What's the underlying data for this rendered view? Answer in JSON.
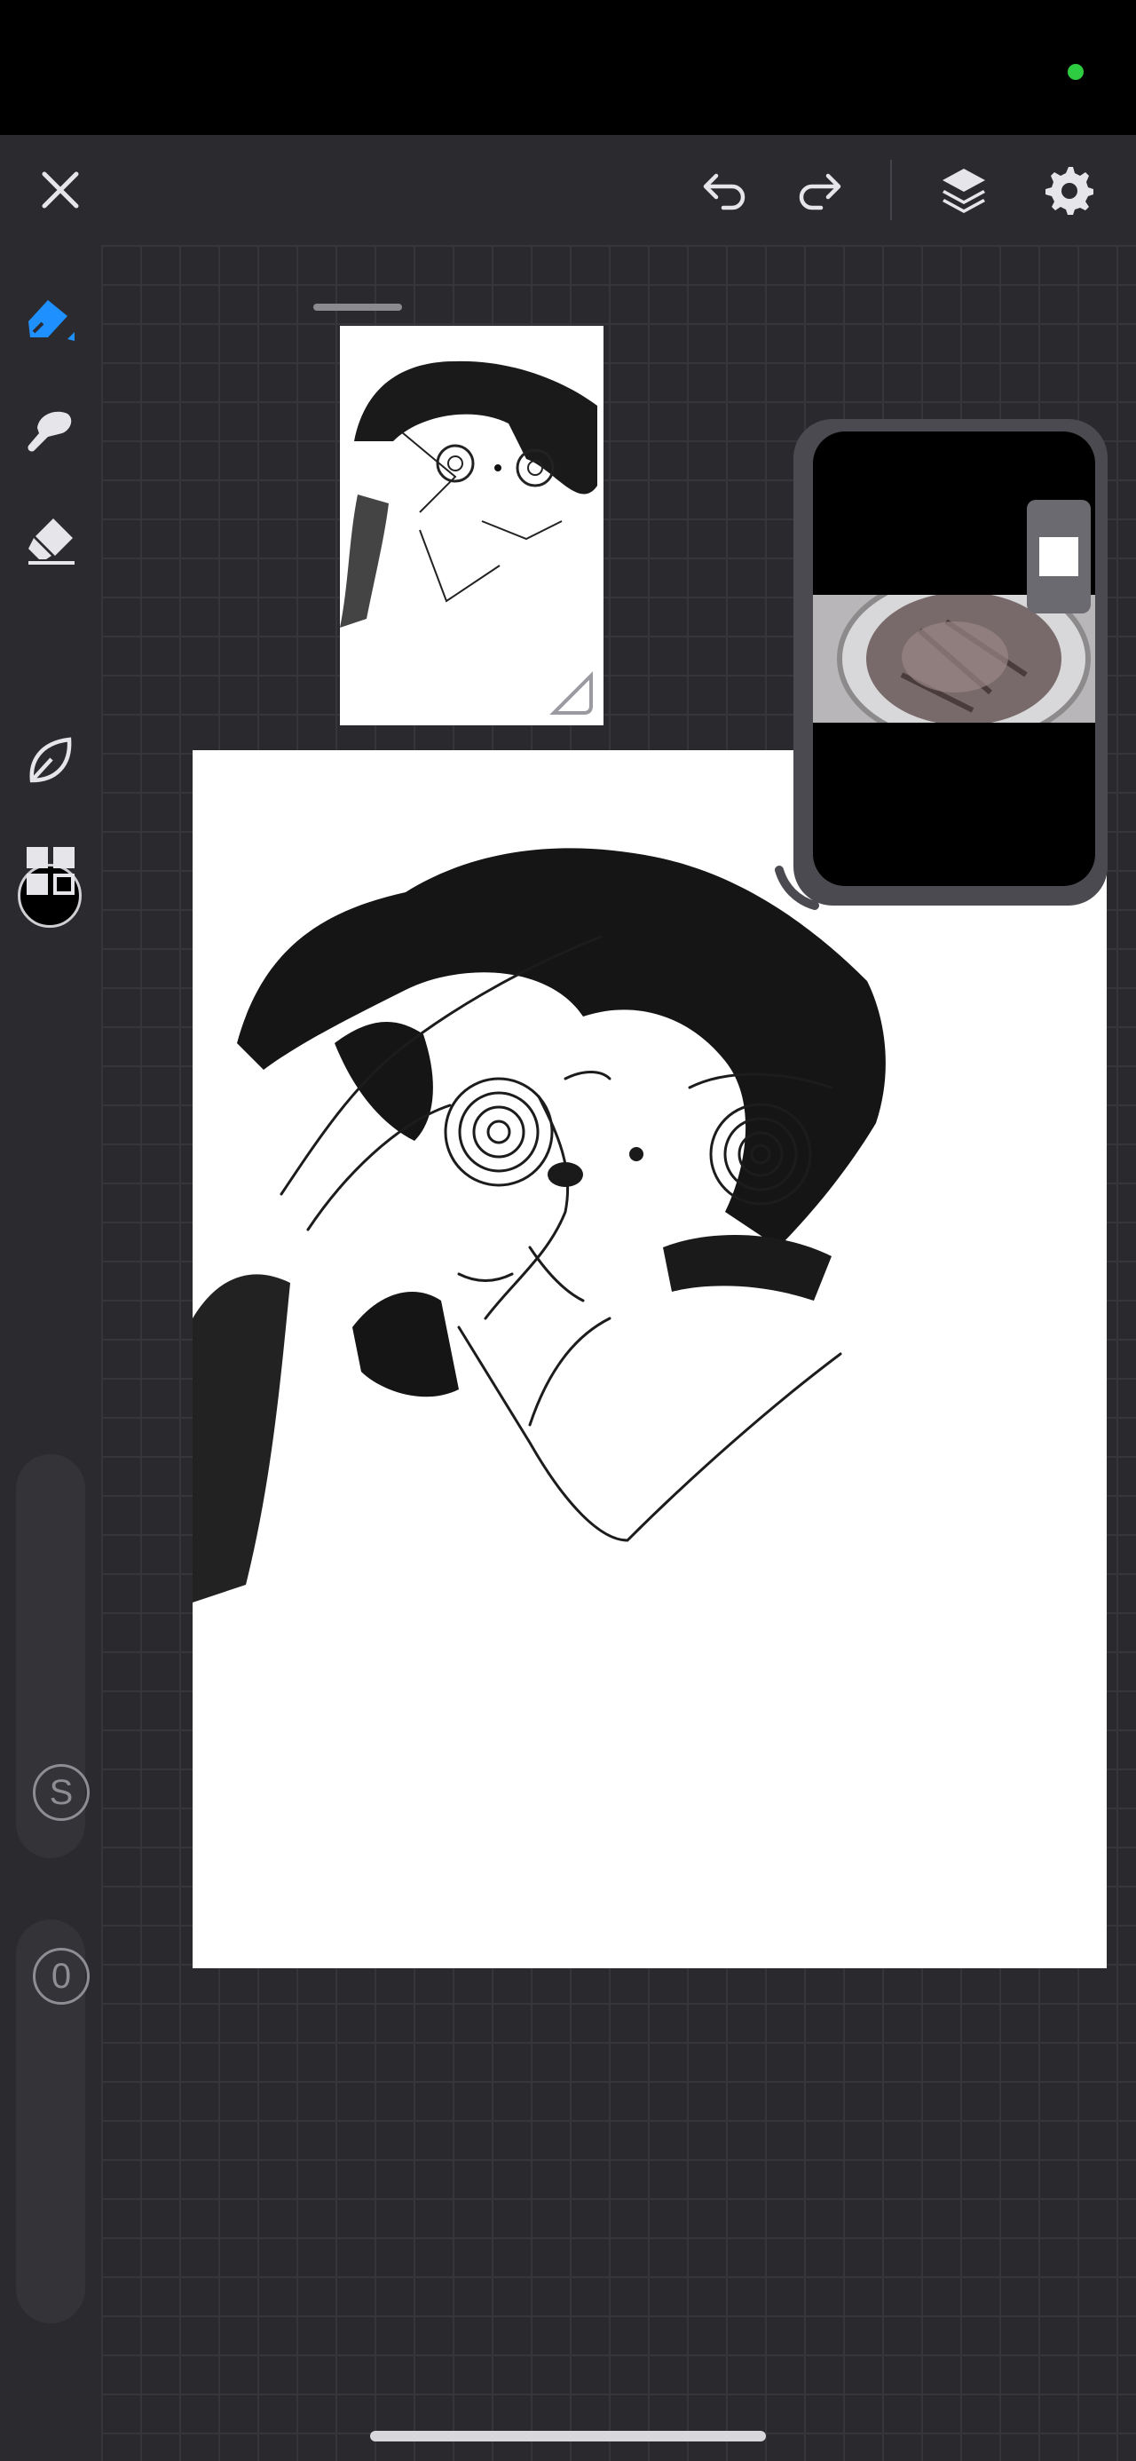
{
  "status": {
    "indicator_color": "#2ecc40"
  },
  "toolbar": {
    "close_icon": "close-icon",
    "undo_icon": "undo-icon",
    "redo_icon": "redo-icon",
    "layers_icon": "layers-icon",
    "settings_icon": "gear-icon"
  },
  "tools": {
    "items": [
      {
        "name": "pen",
        "icon": "pen-icon",
        "active": true
      },
      {
        "name": "smudge",
        "icon": "smudge-icon",
        "active": false
      },
      {
        "name": "eraser",
        "icon": "eraser-icon",
        "active": false
      },
      {
        "name": "color",
        "icon": "color-swatch",
        "active": false
      },
      {
        "name": "lasso",
        "icon": "lasso-icon",
        "active": false
      },
      {
        "name": "gallery",
        "icon": "grid-icon",
        "active": false
      }
    ],
    "accent_color": "#1e90ff",
    "current_color": "#000000"
  },
  "sliders": {
    "size_label": "S",
    "opacity_label": "0"
  },
  "colors": {
    "background": "#2a2a2e",
    "toolbar": "#2b2b2f",
    "canvas": "#ffffff",
    "icon": "#e6e6ea"
  }
}
